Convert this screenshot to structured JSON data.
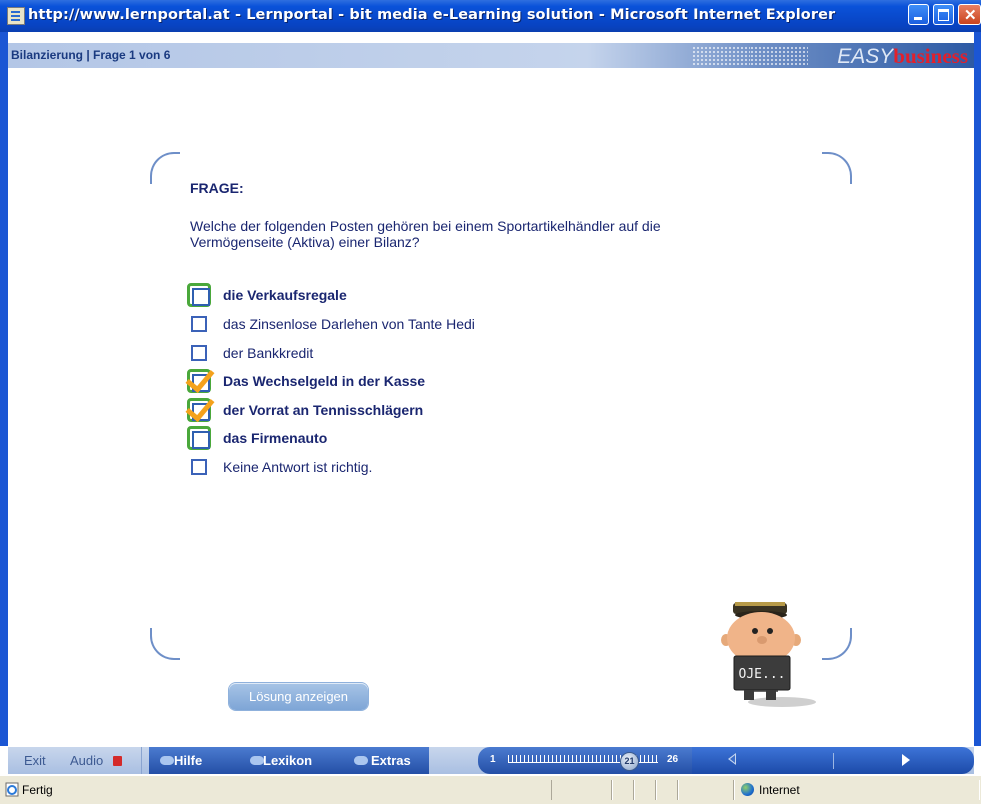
{
  "window": {
    "title": "http://www.lernportal.at - Lernportal - bit media e-Learning solution - Microsoft Internet Explorer"
  },
  "course": {
    "breadcrumb": "Bilanzierung | Frage 1 von 6",
    "brand_easy": "EASY",
    "brand_business": "business"
  },
  "question": {
    "label": "FRAGE:",
    "text": "Welche der folgenden Posten gehören bei einem Sportartikelhändler auf die Vermögenseite (Aktiva) einer Bilanz?"
  },
  "answers": [
    {
      "text": "die Verkaufsregale",
      "highlighted": true,
      "checked": false
    },
    {
      "text": "das Zinsenlose Darlehen von Tante Hedi",
      "highlighted": false,
      "checked": false
    },
    {
      "text": "der Bankkredit",
      "highlighted": false,
      "checked": false
    },
    {
      "text": "Das Wechselgeld in der Kasse",
      "highlighted": true,
      "checked": true
    },
    {
      "text": "der Vorrat an Tennisschlägern",
      "highlighted": true,
      "checked": true
    },
    {
      "text": "das Firmenauto",
      "highlighted": true,
      "checked": false
    },
    {
      "text": "Keine Antwort ist richtig.",
      "highlighted": false,
      "checked": false
    }
  ],
  "solution_button": "Lösung anzeigen",
  "character": {
    "sign_text": "OJE..."
  },
  "toolbar": {
    "exit": "Exit",
    "audio": "Audio",
    "help": "Hilfe",
    "lexicon": "Lexikon",
    "extras": "Extras",
    "progress_start": "1",
    "progress_current": "21",
    "progress_end": "26"
  },
  "statusbar": {
    "status": "Fertig",
    "zone": "Internet"
  },
  "colors": {
    "text_navy": "#1a2670",
    "highlight_green": "#4aa83b",
    "check_orange": "#f4a21c",
    "toolbar_blue": "#244fa6",
    "brand_red": "#e2202b"
  }
}
